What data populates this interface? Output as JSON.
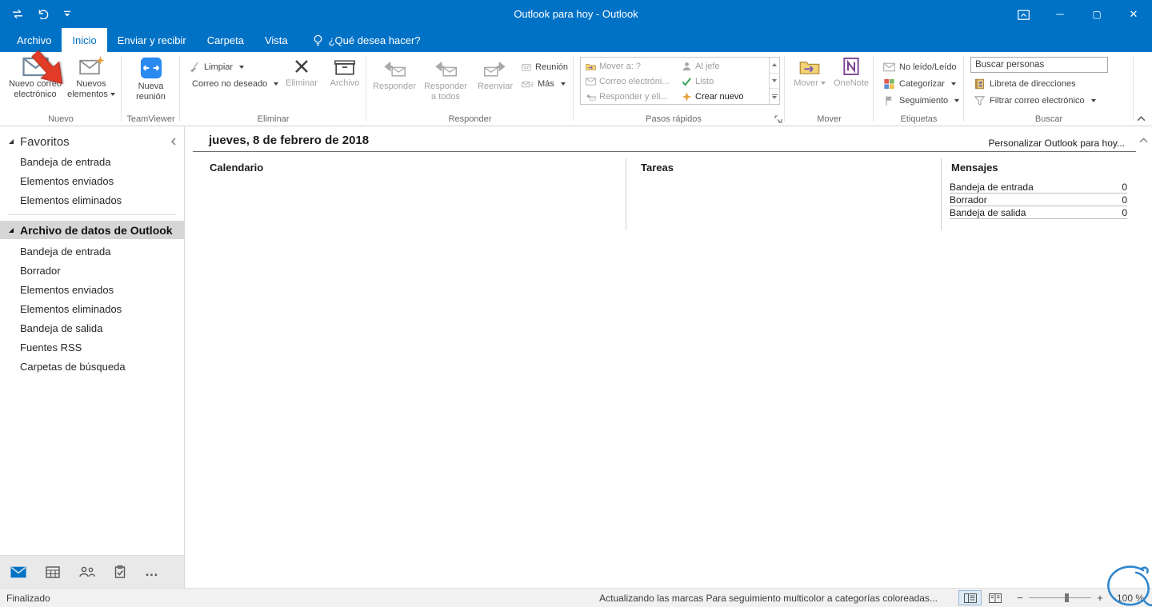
{
  "colors": {
    "titlebar_blue": "#0072c6",
    "active_tab_text": "#0070c0",
    "annotation_red": "#e23b27",
    "watermark_blue": "#3087cd",
    "selected_folder_bg": "#d6d6d6"
  },
  "icons": {
    "minimize": "─",
    "maximize": "▢",
    "close": "✕",
    "ellipsis": "…",
    "zoom_minus": "−",
    "zoom_plus": "+"
  },
  "title_bar": {
    "title": "Outlook para hoy  -  Outlook"
  },
  "tabs": {
    "archivo": "Archivo",
    "inicio": "Inicio",
    "enviar_y_recibir": "Enviar y recibir",
    "carpeta": "Carpeta",
    "vista": "Vista",
    "tell_me": "¿Qué desea hacer?"
  },
  "ribbon": {
    "nuevo": {
      "label": "Nuevo",
      "nuevo_correo": "Nuevo correo\nelectrónico",
      "nuevos_elementos": "Nuevos\nelementos"
    },
    "teamviewer": {
      "label": "TeamViewer",
      "nueva_reunion": "Nueva\nreunión"
    },
    "eliminar": {
      "label": "Eliminar",
      "limpiar": "Limpiar",
      "correo_no_deseado": "Correo no deseado",
      "eliminar": "Eliminar",
      "archivo": "Archivo"
    },
    "responder": {
      "label": "Responder",
      "responder": "Responder",
      "responder_a_todos": "Responder\na todos",
      "reenviar": "Reenviar",
      "reunion": "Reunión",
      "mas": "Más"
    },
    "pasos_rapidos": {
      "label": "Pasos rápidos",
      "items": [
        "Mover a: ?",
        "Correo electróni...",
        "Responder y eli...",
        "Al jefe",
        "Listo",
        "Crear nuevo"
      ]
    },
    "mover": {
      "label": "Mover",
      "mover": "Mover",
      "onenote": "OneNote"
    },
    "etiquetas": {
      "label": "Etiquetas",
      "no_leido": "No leído/Leído",
      "categorizar": "Categorizar",
      "seguimiento": "Seguimiento"
    },
    "buscar": {
      "label": "Buscar",
      "buscar_personas_placeholder": "Buscar personas",
      "libreta": "Libreta de direcciones",
      "filtrar": "Filtrar correo electrónico"
    }
  },
  "sidebar": {
    "favoritos": {
      "header": "Favoritos",
      "items": [
        "Bandeja de entrada",
        "Elementos enviados",
        "Elementos eliminados"
      ]
    },
    "archivo_datos": {
      "header": "Archivo de datos de Outlook",
      "items": [
        "Bandeja de entrada",
        "Borrador",
        "Elementos enviados",
        "Elementos eliminados",
        "Bandeja de salida",
        "Fuentes RSS",
        "Carpetas de búsqueda"
      ]
    }
  },
  "content": {
    "date_heading": "jueves, 8 de febrero de 2018",
    "customize_link": "Personalizar Outlook para hoy...",
    "columns": {
      "calendar": "Calendario",
      "tasks": "Tareas",
      "messages": "Mensajes"
    },
    "messages": [
      {
        "label": "Bandeja de entrada",
        "count": "0"
      },
      {
        "label": "Borrador",
        "count": "0"
      },
      {
        "label": "Bandeja de salida",
        "count": "0"
      }
    ]
  },
  "status_bar": {
    "left": "Finalizado",
    "message": "Actualizando las marcas Para seguimiento multicolor a categorías coloreadas...",
    "zoom": "100 %"
  }
}
